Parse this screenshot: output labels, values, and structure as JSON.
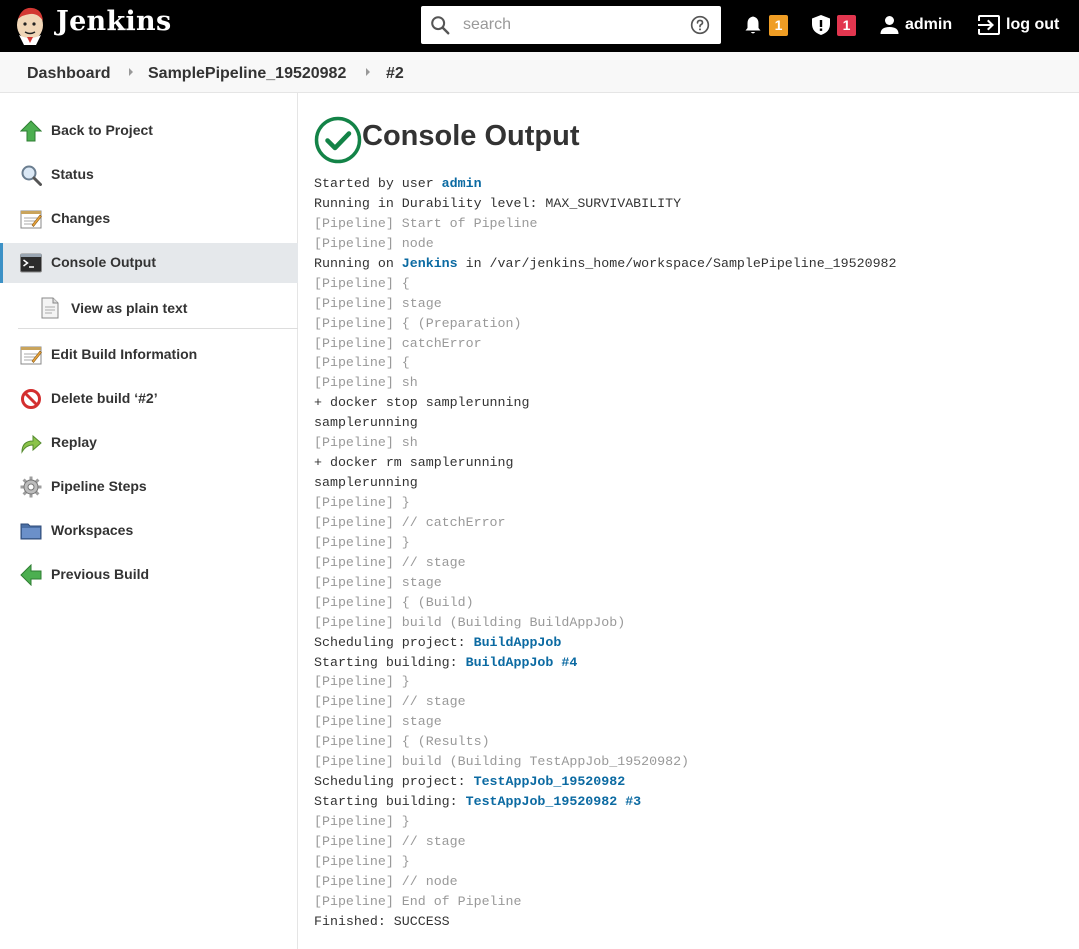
{
  "header": {
    "brand": "Jenkins",
    "search_placeholder": "search",
    "notifications_count": "1",
    "security_count": "1",
    "user": "admin",
    "logout": "log out"
  },
  "breadcrumb": [
    "Dashboard",
    "SamplePipeline_19520982",
    "#2"
  ],
  "sidebar": {
    "items": [
      {
        "label": "Back to Project",
        "icon": "up-arrow-icon"
      },
      {
        "label": "Status",
        "icon": "magnifier-icon"
      },
      {
        "label": "Changes",
        "icon": "notepad-icon"
      },
      {
        "label": "Console Output",
        "icon": "terminal-icon",
        "active": true
      },
      {
        "label": "View as plain text",
        "icon": "document-icon",
        "sub": true
      },
      {
        "label": "Edit Build Information",
        "icon": "notepad-icon"
      },
      {
        "label": "Delete build ‘#2’",
        "icon": "no-entry-icon"
      },
      {
        "label": "Replay",
        "icon": "redo-arrow-icon"
      },
      {
        "label": "Pipeline Steps",
        "icon": "gear-icon"
      },
      {
        "label": "Workspaces",
        "icon": "folder-icon"
      },
      {
        "label": "Previous Build",
        "icon": "left-arrow-icon"
      }
    ]
  },
  "main": {
    "title": "Console Output",
    "status_color": "#138347",
    "link_color": "#0b6aa2"
  },
  "console": {
    "lines": [
      [
        {
          "t": "Started by user "
        },
        {
          "t": "admin",
          "link": true
        }
      ],
      [
        {
          "t": "Running in Durability level: MAX_SURVIVABILITY"
        }
      ],
      [
        {
          "t": "[Pipeline] Start of Pipeline",
          "pipe": true
        }
      ],
      [
        {
          "t": "[Pipeline] node",
          "pipe": true
        }
      ],
      [
        {
          "t": "Running on "
        },
        {
          "t": "Jenkins",
          "link": true
        },
        {
          "t": " in /var/jenkins_home/workspace/SamplePipeline_19520982"
        }
      ],
      [
        {
          "t": "[Pipeline] {",
          "pipe": true
        }
      ],
      [
        {
          "t": "[Pipeline] stage",
          "pipe": true
        }
      ],
      [
        {
          "t": "[Pipeline] { (Preparation)",
          "pipe": true
        }
      ],
      [
        {
          "t": "[Pipeline] catchError",
          "pipe": true
        }
      ],
      [
        {
          "t": "[Pipeline] {",
          "pipe": true
        }
      ],
      [
        {
          "t": "[Pipeline] sh",
          "pipe": true
        }
      ],
      [
        {
          "t": "+ docker stop samplerunning"
        }
      ],
      [
        {
          "t": "samplerunning"
        }
      ],
      [
        {
          "t": "[Pipeline] sh",
          "pipe": true
        }
      ],
      [
        {
          "t": "+ docker rm samplerunning"
        }
      ],
      [
        {
          "t": "samplerunning"
        }
      ],
      [
        {
          "t": "[Pipeline] }",
          "pipe": true
        }
      ],
      [
        {
          "t": "[Pipeline] // catchError",
          "pipe": true
        }
      ],
      [
        {
          "t": "[Pipeline] }",
          "pipe": true
        }
      ],
      [
        {
          "t": "[Pipeline] // stage",
          "pipe": true
        }
      ],
      [
        {
          "t": "[Pipeline] stage",
          "pipe": true
        }
      ],
      [
        {
          "t": "[Pipeline] { (Build)",
          "pipe": true
        }
      ],
      [
        {
          "t": "[Pipeline] build (Building BuildAppJob)",
          "pipe": true
        }
      ],
      [
        {
          "t": "Scheduling project: "
        },
        {
          "t": "BuildAppJob",
          "link": true
        }
      ],
      [
        {
          "t": "Starting building: "
        },
        {
          "t": "BuildAppJob #4",
          "link": true
        }
      ],
      [
        {
          "t": "[Pipeline] }",
          "pipe": true
        }
      ],
      [
        {
          "t": "[Pipeline] // stage",
          "pipe": true
        }
      ],
      [
        {
          "t": "[Pipeline] stage",
          "pipe": true
        }
      ],
      [
        {
          "t": "[Pipeline] { (Results)",
          "pipe": true
        }
      ],
      [
        {
          "t": "[Pipeline] build (Building TestAppJob_19520982)",
          "pipe": true
        }
      ],
      [
        {
          "t": "Scheduling project: "
        },
        {
          "t": "TestAppJob_19520982",
          "link": true
        }
      ],
      [
        {
          "t": "Starting building: "
        },
        {
          "t": "TestAppJob_19520982 #3",
          "link": true
        }
      ],
      [
        {
          "t": "[Pipeline] }",
          "pipe": true
        }
      ],
      [
        {
          "t": "[Pipeline] // stage",
          "pipe": true
        }
      ],
      [
        {
          "t": "[Pipeline] }",
          "pipe": true
        }
      ],
      [
        {
          "t": "[Pipeline] // node",
          "pipe": true
        }
      ],
      [
        {
          "t": "[Pipeline] End of Pipeline",
          "pipe": true
        }
      ],
      [
        {
          "t": "Finished: SUCCESS"
        }
      ]
    ]
  }
}
